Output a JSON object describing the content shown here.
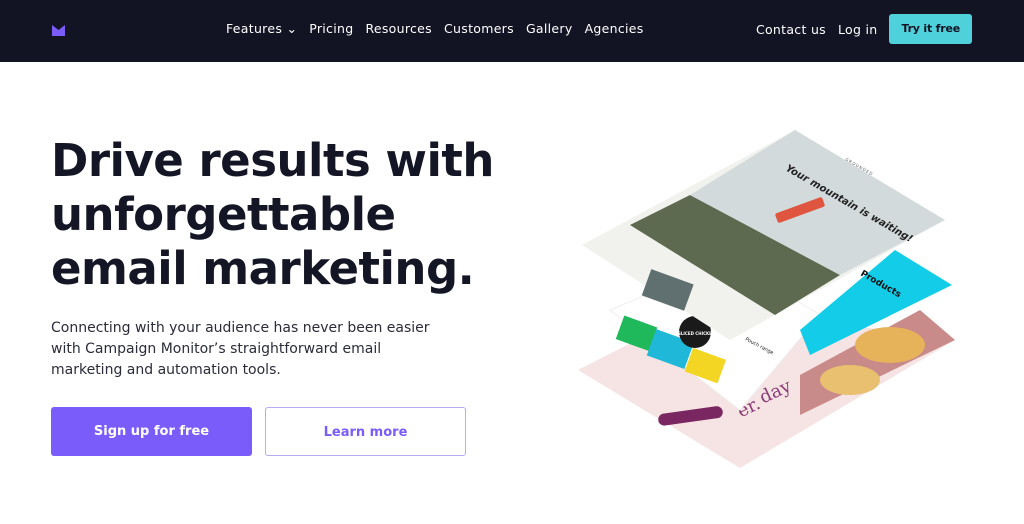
{
  "nav": {
    "logo": "Campaign Monitor",
    "items": [
      {
        "label": "Features",
        "icon": "chevron-down-icon"
      },
      {
        "label": "Pricing"
      },
      {
        "label": "Resources"
      },
      {
        "label": "Customers"
      },
      {
        "label": "Gallery"
      },
      {
        "label": "Agencies"
      }
    ],
    "contact": "Contact us",
    "login": "Log in",
    "try": "Try it free"
  },
  "hero": {
    "title": "Drive results with unforgettable email marketing.",
    "subtitle": "Connecting with your audience has never been easier with Campaign Monitor’s straightforward email marketing and automation tools.",
    "primary_button": "Sign up for free",
    "secondary_button": "Learn more"
  },
  "illustration": {
    "headline": "Your mountain is waiting!",
    "brand": "GROUNDED",
    "products": "Products",
    "badge": "SLICED CHICKEN",
    "pouch": "Pouch range",
    "day": "day",
    "er": "er."
  },
  "colors": {
    "nav_bg": "#121424",
    "accent": "#7a5cfa",
    "try_button": "#4fd1dc"
  }
}
